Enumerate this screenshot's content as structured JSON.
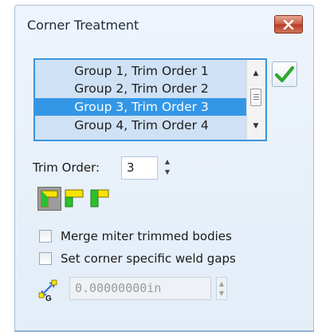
{
  "dialog": {
    "title": "Corner Treatment"
  },
  "groups_list": {
    "items": [
      "Group 1, Trim Order 1",
      "Group 2, Trim Order 2",
      "Group 3, Trim Order 3",
      "Group 4, Trim Order 4"
    ],
    "selected_index": 2
  },
  "trim_order": {
    "label": "Trim Order:",
    "value": "3"
  },
  "corner_styles": [
    {
      "name": "end-trim",
      "active": true
    },
    {
      "name": "end-miter",
      "active": false
    },
    {
      "name": "end-butt",
      "active": false
    }
  ],
  "options": {
    "merge_label": "Merge miter trimmed bodies",
    "merge_checked": false,
    "weld_gaps_label": "Set corner specific weld gaps",
    "weld_gaps_checked": false
  },
  "weld_gap": {
    "value": "0.00000000in",
    "enabled": false
  },
  "icons": {
    "close": "close-icon",
    "ok": "checkmark-icon",
    "gap": "weld-gap-icon"
  },
  "colors": {
    "selection": "#3397e6",
    "list_background": "#cfe1f4",
    "close_button": "#c95c45",
    "check_green": "#2fa82f",
    "style_yellow": "#f6e400",
    "style_green": "#2cc02c"
  }
}
